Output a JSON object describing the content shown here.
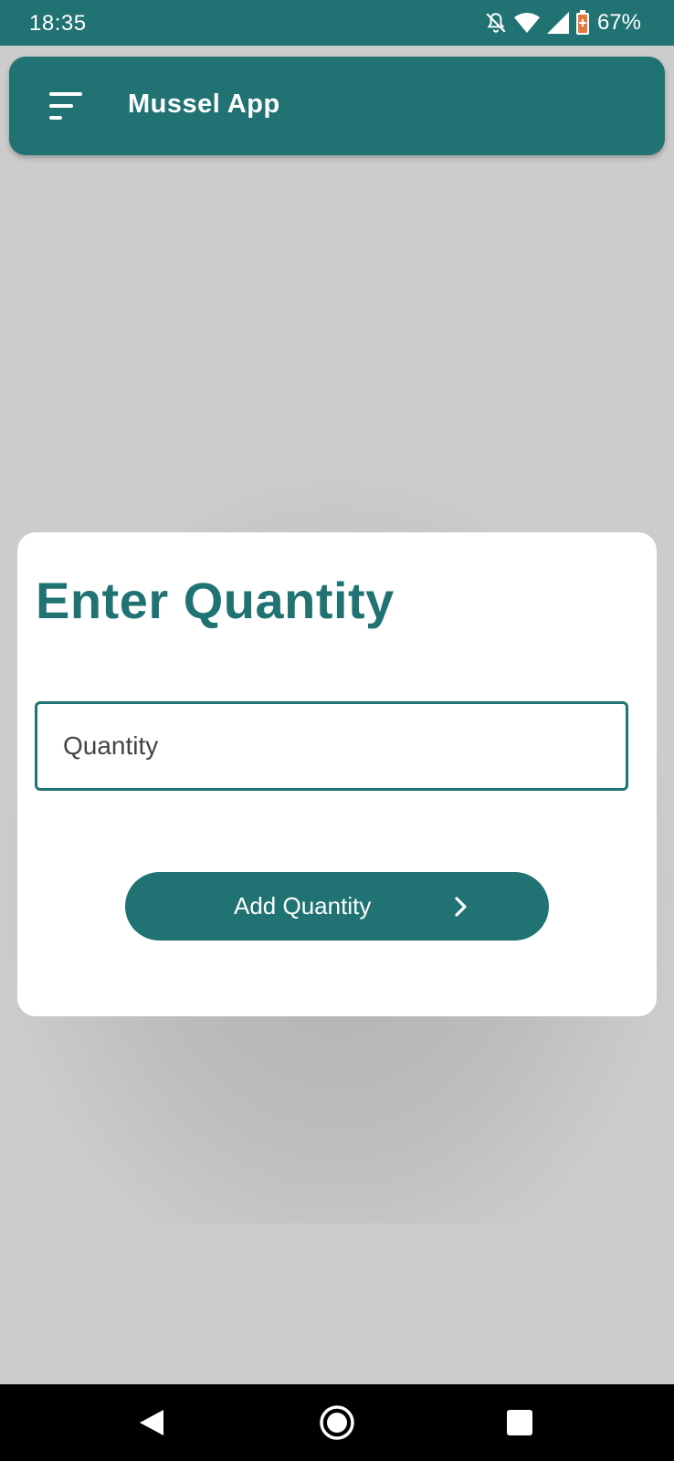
{
  "status_bar": {
    "time": "18:35",
    "battery_percent": "67%",
    "icons": [
      "notifications-off-icon",
      "wifi-icon",
      "signal-icon",
      "battery-saver-icon"
    ]
  },
  "app_bar": {
    "title": "Mussel App",
    "menu_icon": "sort-menu-icon"
  },
  "dialog": {
    "title": "Enter Quantity",
    "quantity_placeholder": "Quantity",
    "quantity_value": "",
    "add_button_label": "Add Quantity",
    "add_button_icon": "chevron-right-icon"
  },
  "nav_bar": {
    "icons": [
      "back-icon",
      "home-icon",
      "recents-icon"
    ]
  },
  "colors": {
    "primary": "#217272",
    "background_dim": "#cccccc",
    "surface": "#ffffff",
    "battery_accent": "#e5793e"
  }
}
